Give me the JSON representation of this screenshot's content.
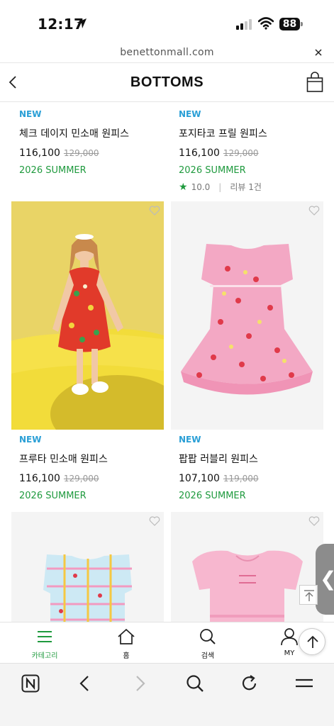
{
  "status_bar": {
    "time": "12:17",
    "battery": "88"
  },
  "browser": {
    "url": "benettonmall.com"
  },
  "header": {
    "title": "BOTTOMS"
  },
  "products": [
    {
      "badge": "NEW",
      "name": "체크 데이지 민소매 원피스",
      "price": "116,100",
      "original_price": "129,000",
      "season": "2026 SUMMER"
    },
    {
      "badge": "NEW",
      "name": "포지타코 프릴 원피스",
      "price": "116,100",
      "original_price": "129,000",
      "season": "2026 SUMMER",
      "rating": "10.0",
      "review": "리뷰 1건"
    },
    {
      "badge": "NEW",
      "name": "프루타 민소매 원피스",
      "price": "116,100",
      "original_price": "129,000",
      "season": "2026 SUMMER"
    },
    {
      "badge": "NEW",
      "name": "팝팝 러블리 원피스",
      "price": "107,100",
      "original_price": "119,000",
      "season": "2026 SUMMER"
    }
  ],
  "bottom_nav": [
    {
      "label": "카테고리",
      "icon": "menu-icon",
      "active": true
    },
    {
      "label": "홈",
      "icon": "home-icon"
    },
    {
      "label": "검색",
      "icon": "search-icon"
    },
    {
      "label": "MY",
      "icon": "user-icon"
    }
  ],
  "colors": {
    "accent_green": "#1f9a3e",
    "new_badge": "#2a9fd6"
  }
}
